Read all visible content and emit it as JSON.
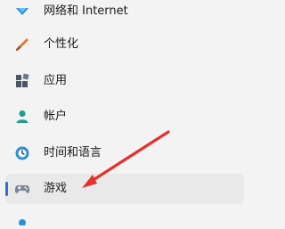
{
  "sidebar": {
    "items": [
      {
        "label": "网络和 Internet",
        "icon": "network-icon"
      },
      {
        "label": "个性化",
        "icon": "brush-icon"
      },
      {
        "label": "应用",
        "icon": "apps-icon"
      },
      {
        "label": "帐户",
        "icon": "account-icon"
      },
      {
        "label": "时间和语言",
        "icon": "globe-clock-icon"
      },
      {
        "label": "游戏",
        "icon": "gamepad-icon",
        "selected": true
      }
    ]
  },
  "colors": {
    "accent": "#2f6fce",
    "annotation_arrow": "#e8302a",
    "selected_bg": "#e9e9e9"
  }
}
